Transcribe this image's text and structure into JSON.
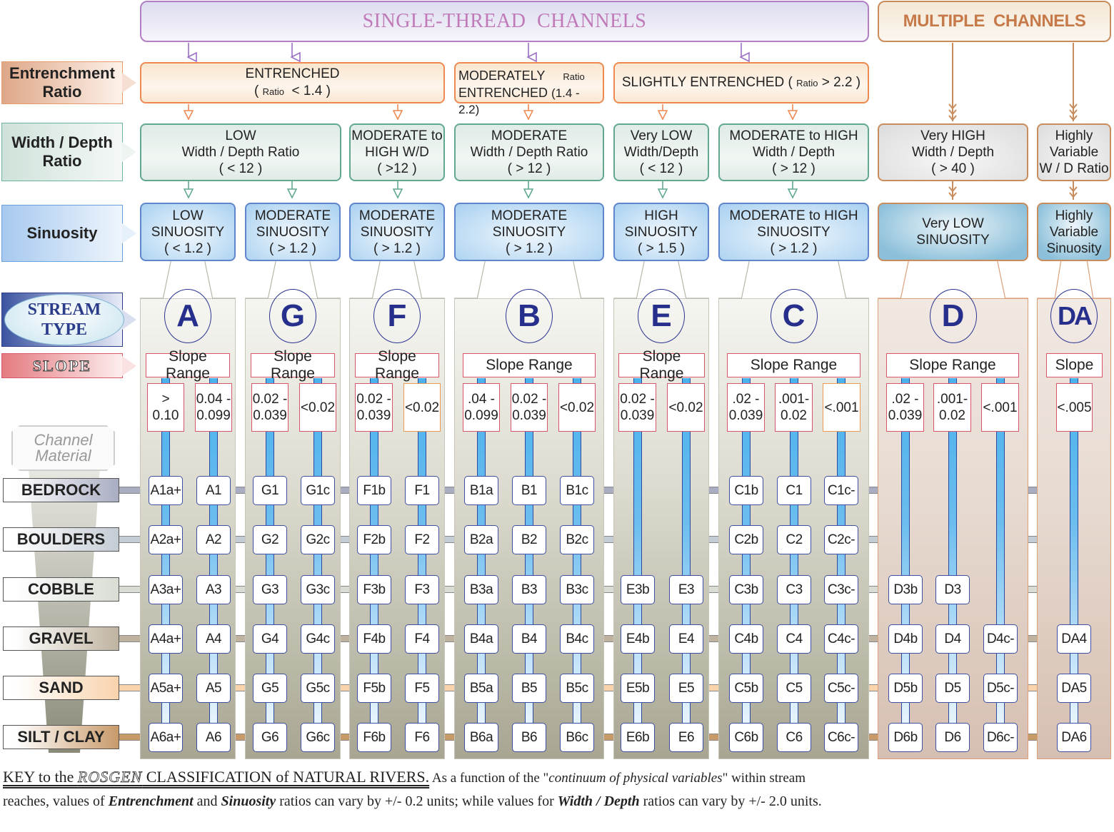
{
  "headers": {
    "single_thread": "SINGLE-THREAD  CHANNELS",
    "multiple": "MULTIPLE  CHANNELS"
  },
  "side_labels": {
    "entrenchment": [
      "Entrenchment",
      "Ratio"
    ],
    "width_depth": [
      "Width / Depth",
      "Ratio"
    ],
    "sinuosity": "Sinuosity",
    "stream_type": [
      "STREAM",
      "TYPE"
    ],
    "slope": "SLOPE",
    "channel_material": [
      "Channel",
      "Material"
    ]
  },
  "entrenchment": [
    {
      "title": "ENTRENCHED",
      "ratio_word": "Ratio",
      "ratio": "< 1.4"
    },
    {
      "title_lines": [
        "MODERATELY",
        "ENTRENCHED"
      ],
      "ratio_word": "Ratio",
      "ratio": "(1.4 - 2.2)"
    },
    {
      "title": "SLIGHTLY  ENTRENCHED (",
      "ratio_word": "Ratio",
      "ratio": "> 2.2 )"
    }
  ],
  "width_depth": [
    {
      "lines": [
        "LOW",
        "Width / Depth Ratio",
        "( < 12 )"
      ]
    },
    {
      "lines": [
        "MODERATE to",
        "HIGH   W/D",
        "( >12 )"
      ]
    },
    {
      "lines": [
        "MODERATE",
        "Width / Depth Ratio",
        "( > 12 )"
      ]
    },
    {
      "lines": [
        "Very LOW",
        "Width/Depth",
        "( < 12 )"
      ]
    },
    {
      "lines": [
        "MODERATE to HIGH",
        "Width / Depth",
        "( > 12 )"
      ]
    },
    {
      "lines": [
        "Very HIGH",
        "Width / Depth",
        "( > 40 )"
      ]
    },
    {
      "lines": [
        "Highly",
        "Variable",
        "W / D Ratio"
      ]
    }
  ],
  "sinuosity": [
    {
      "lines": [
        "LOW",
        "SINUOSITY",
        "( < 1.2 )"
      ]
    },
    {
      "lines": [
        "MODERATE",
        "SINUOSITY",
        "( > 1.2 )"
      ]
    },
    {
      "lines": [
        "MODERATE",
        "SINUOSITY",
        "( > 1.2 )"
      ]
    },
    {
      "lines": [
        "MODERATE",
        "SINUOSITY",
        "( > 1.2 )"
      ]
    },
    {
      "lines": [
        "HIGH",
        "SINUOSITY",
        "( > 1.5 )"
      ]
    },
    {
      "lines": [
        "MODERATE to HIGH",
        "SINUOSITY",
        "( > 1.2 )"
      ]
    },
    {
      "lines": [
        "Very LOW",
        "SINUOSITY"
      ]
    },
    {
      "lines": [
        "Highly",
        "Variable",
        "Sinuosity"
      ]
    }
  ],
  "materials": [
    "BEDROCK",
    "BOULDERS",
    "COBBLE",
    "GRAVEL",
    "SAND",
    "SILT / CLAY"
  ],
  "material_colors": [
    "#a9adc2",
    "#c4ccd4",
    "#d8ddd4",
    "#bfb3a0",
    "#f8d3ac",
    "#c89a6a"
  ],
  "stream_types": [
    {
      "letter": "A",
      "slope_header": "Slope Range",
      "slopes": [
        [
          "> ",
          "0.10"
        ],
        [
          "0.04 -",
          "0.099"
        ]
      ],
      "cells": [
        [
          "A1a+",
          "A2a+",
          "A3a+",
          "A4a+",
          "A5a+",
          "A6a+"
        ],
        [
          "A1",
          "A2",
          "A3",
          "A4",
          "A5",
          "A6"
        ]
      ]
    },
    {
      "letter": "G",
      "slope_header": "Slope Range",
      "slopes": [
        [
          "0.02 -",
          "0.039"
        ],
        [
          "<0.02"
        ]
      ],
      "cells": [
        [
          "G1",
          "G2",
          "G3",
          "G4",
          "G5",
          "G6"
        ],
        [
          "G1c",
          "G2c",
          "G3c",
          "G4c",
          "G5c",
          "G6c"
        ]
      ]
    },
    {
      "letter": "F",
      "slope_header": "Slope Range",
      "slopes": [
        [
          "0.02 -",
          "0.039"
        ],
        [
          "<0.02"
        ]
      ],
      "cells": [
        [
          "F1b",
          "F2b",
          "F3b",
          "F4b",
          "F5b",
          "F6b"
        ],
        [
          "F1",
          "F2",
          "F3",
          "F4",
          "F5",
          "F6"
        ]
      ]
    },
    {
      "letter": "B",
      "slope_header": "Slope  Range",
      "slopes": [
        [
          ".04 -",
          "0.099"
        ],
        [
          "0.02 -",
          "0.039"
        ],
        [
          "<0.02"
        ]
      ],
      "cells": [
        [
          "B1a",
          "B2a",
          "B3a",
          "B4a",
          "B5a",
          "B6a"
        ],
        [
          "B1",
          "B2",
          "B3",
          "B4",
          "B5",
          "B6"
        ],
        [
          "B1c",
          "B2c",
          "B3c",
          "B4c",
          "B5c",
          "B6c"
        ]
      ]
    },
    {
      "letter": "E",
      "slope_header": "Slope Range",
      "slopes": [
        [
          "0.02 -",
          "0.039"
        ],
        [
          "<0.02"
        ]
      ],
      "cells": [
        [
          "",
          "",
          "E3b",
          "E4b",
          "E5b",
          "E6b"
        ],
        [
          "",
          "",
          "E3",
          "E4",
          "E5",
          "E6"
        ]
      ]
    },
    {
      "letter": "C",
      "slope_header": "Slope  Range",
      "slopes": [
        [
          ".02 -",
          "0.039"
        ],
        [
          ".001-",
          "0.02"
        ],
        [
          "<.001"
        ]
      ],
      "cells": [
        [
          "C1b",
          "C2b",
          "C3b",
          "C4b",
          "C5b",
          "C6b"
        ],
        [
          "C1",
          "C2",
          "C3",
          "C4",
          "C5",
          "C6"
        ],
        [
          "C1c-",
          "C2c-",
          "C3c-",
          "C4c-",
          "C5c-",
          "C6c-"
        ]
      ]
    },
    {
      "letter": "D",
      "slope_header": "Slope  Range",
      "slopes": [
        [
          ".02 -",
          "0.039"
        ],
        [
          ".001-",
          "0.02"
        ],
        [
          "<.001"
        ]
      ],
      "cells": [
        [
          "",
          "",
          "D3b",
          "D4b",
          "D5b",
          "D6b"
        ],
        [
          "",
          "",
          "D3",
          "D4",
          "D5",
          "D6"
        ],
        [
          "",
          "",
          "",
          "D4c-",
          "D5c-",
          "D6c-"
        ]
      ]
    },
    {
      "letter": "DA",
      "slope_header": "Slope",
      "slopes": [
        [
          "<.005"
        ]
      ],
      "cells": [
        [
          "",
          "",
          "",
          "DA4",
          "DA5",
          "DA6"
        ]
      ]
    }
  ],
  "footer": {
    "line1_prefix": "KEY to the ",
    "line1_rosgen": "ROSGEN",
    "line1_suffix": "  CLASSIFICATION of NATURAL RIVERS.",
    "line1_rest_a": "   As a function of the  \"",
    "line1_rest_italic": "continuum of physical variables",
    "line1_rest_b": "\"  within stream",
    "line2_a": "reaches, values of  ",
    "line2_entrenchment": "Entrenchment",
    "line2_and": " and ",
    "line2_sinuosity": "Sinuosity",
    "line2_b": "  ratios can vary by +/- 0.2 units; while values for ",
    "line2_wd": "Width / Depth",
    "line2_c": "  ratios can vary by +/- 2.0 units."
  }
}
